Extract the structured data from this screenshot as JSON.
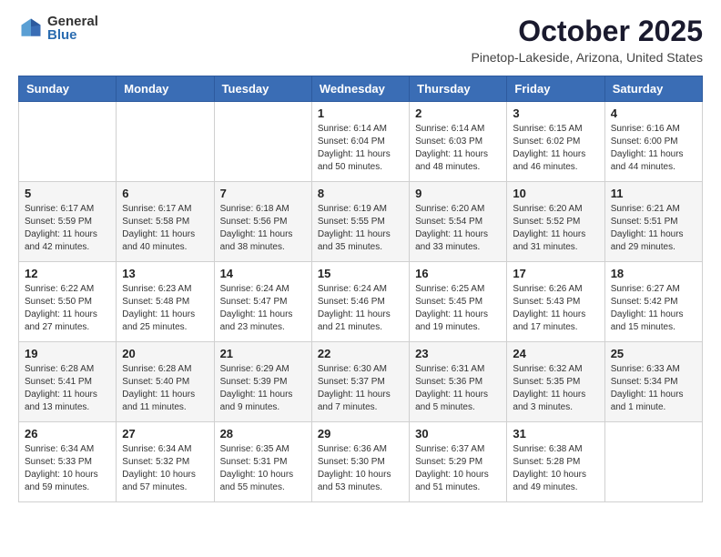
{
  "logo": {
    "general": "General",
    "blue": "Blue"
  },
  "title": "October 2025",
  "location": "Pinetop-Lakeside, Arizona, United States",
  "days_of_week": [
    "Sunday",
    "Monday",
    "Tuesday",
    "Wednesday",
    "Thursday",
    "Friday",
    "Saturday"
  ],
  "weeks": [
    [
      {
        "day": "",
        "info": ""
      },
      {
        "day": "",
        "info": ""
      },
      {
        "day": "",
        "info": ""
      },
      {
        "day": "1",
        "info": "Sunrise: 6:14 AM\nSunset: 6:04 PM\nDaylight: 11 hours\nand 50 minutes."
      },
      {
        "day": "2",
        "info": "Sunrise: 6:14 AM\nSunset: 6:03 PM\nDaylight: 11 hours\nand 48 minutes."
      },
      {
        "day": "3",
        "info": "Sunrise: 6:15 AM\nSunset: 6:02 PM\nDaylight: 11 hours\nand 46 minutes."
      },
      {
        "day": "4",
        "info": "Sunrise: 6:16 AM\nSunset: 6:00 PM\nDaylight: 11 hours\nand 44 minutes."
      }
    ],
    [
      {
        "day": "5",
        "info": "Sunrise: 6:17 AM\nSunset: 5:59 PM\nDaylight: 11 hours\nand 42 minutes."
      },
      {
        "day": "6",
        "info": "Sunrise: 6:17 AM\nSunset: 5:58 PM\nDaylight: 11 hours\nand 40 minutes."
      },
      {
        "day": "7",
        "info": "Sunrise: 6:18 AM\nSunset: 5:56 PM\nDaylight: 11 hours\nand 38 minutes."
      },
      {
        "day": "8",
        "info": "Sunrise: 6:19 AM\nSunset: 5:55 PM\nDaylight: 11 hours\nand 35 minutes."
      },
      {
        "day": "9",
        "info": "Sunrise: 6:20 AM\nSunset: 5:54 PM\nDaylight: 11 hours\nand 33 minutes."
      },
      {
        "day": "10",
        "info": "Sunrise: 6:20 AM\nSunset: 5:52 PM\nDaylight: 11 hours\nand 31 minutes."
      },
      {
        "day": "11",
        "info": "Sunrise: 6:21 AM\nSunset: 5:51 PM\nDaylight: 11 hours\nand 29 minutes."
      }
    ],
    [
      {
        "day": "12",
        "info": "Sunrise: 6:22 AM\nSunset: 5:50 PM\nDaylight: 11 hours\nand 27 minutes."
      },
      {
        "day": "13",
        "info": "Sunrise: 6:23 AM\nSunset: 5:48 PM\nDaylight: 11 hours\nand 25 minutes."
      },
      {
        "day": "14",
        "info": "Sunrise: 6:24 AM\nSunset: 5:47 PM\nDaylight: 11 hours\nand 23 minutes."
      },
      {
        "day": "15",
        "info": "Sunrise: 6:24 AM\nSunset: 5:46 PM\nDaylight: 11 hours\nand 21 minutes."
      },
      {
        "day": "16",
        "info": "Sunrise: 6:25 AM\nSunset: 5:45 PM\nDaylight: 11 hours\nand 19 minutes."
      },
      {
        "day": "17",
        "info": "Sunrise: 6:26 AM\nSunset: 5:43 PM\nDaylight: 11 hours\nand 17 minutes."
      },
      {
        "day": "18",
        "info": "Sunrise: 6:27 AM\nSunset: 5:42 PM\nDaylight: 11 hours\nand 15 minutes."
      }
    ],
    [
      {
        "day": "19",
        "info": "Sunrise: 6:28 AM\nSunset: 5:41 PM\nDaylight: 11 hours\nand 13 minutes."
      },
      {
        "day": "20",
        "info": "Sunrise: 6:28 AM\nSunset: 5:40 PM\nDaylight: 11 hours\nand 11 minutes."
      },
      {
        "day": "21",
        "info": "Sunrise: 6:29 AM\nSunset: 5:39 PM\nDaylight: 11 hours\nand 9 minutes."
      },
      {
        "day": "22",
        "info": "Sunrise: 6:30 AM\nSunset: 5:37 PM\nDaylight: 11 hours\nand 7 minutes."
      },
      {
        "day": "23",
        "info": "Sunrise: 6:31 AM\nSunset: 5:36 PM\nDaylight: 11 hours\nand 5 minutes."
      },
      {
        "day": "24",
        "info": "Sunrise: 6:32 AM\nSunset: 5:35 PM\nDaylight: 11 hours\nand 3 minutes."
      },
      {
        "day": "25",
        "info": "Sunrise: 6:33 AM\nSunset: 5:34 PM\nDaylight: 11 hours\nand 1 minute."
      }
    ],
    [
      {
        "day": "26",
        "info": "Sunrise: 6:34 AM\nSunset: 5:33 PM\nDaylight: 10 hours\nand 59 minutes."
      },
      {
        "day": "27",
        "info": "Sunrise: 6:34 AM\nSunset: 5:32 PM\nDaylight: 10 hours\nand 57 minutes."
      },
      {
        "day": "28",
        "info": "Sunrise: 6:35 AM\nSunset: 5:31 PM\nDaylight: 10 hours\nand 55 minutes."
      },
      {
        "day": "29",
        "info": "Sunrise: 6:36 AM\nSunset: 5:30 PM\nDaylight: 10 hours\nand 53 minutes."
      },
      {
        "day": "30",
        "info": "Sunrise: 6:37 AM\nSunset: 5:29 PM\nDaylight: 10 hours\nand 51 minutes."
      },
      {
        "day": "31",
        "info": "Sunrise: 6:38 AM\nSunset: 5:28 PM\nDaylight: 10 hours\nand 49 minutes."
      },
      {
        "day": "",
        "info": ""
      }
    ]
  ]
}
